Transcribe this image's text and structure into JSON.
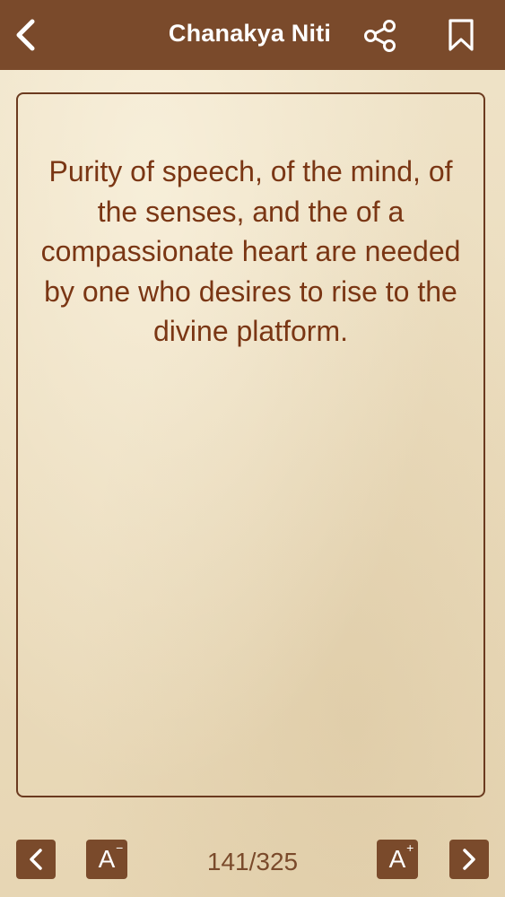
{
  "header": {
    "title": "Chanakya Niti",
    "icons": {
      "back": "chevron-left-icon",
      "share": "share-icon",
      "bookmark": "bookmark-icon"
    }
  },
  "quote": {
    "text": "Purity of speech, of the mind, of the senses, and the of a compassionate heart are needed by one who desires to rise to the divine platform."
  },
  "footer": {
    "page_counter": "141/325",
    "font_decrease_label": "A",
    "font_decrease_sign": "−",
    "font_increase_label": "A",
    "font_increase_sign": "+",
    "icons": {
      "prev": "chevron-left-icon",
      "next": "chevron-right-icon"
    }
  },
  "colors": {
    "header_bg": "#7a4a2b",
    "quote_text": "#7a3614",
    "card_border": "#6b3a1f",
    "background": "#ebdcbd"
  }
}
